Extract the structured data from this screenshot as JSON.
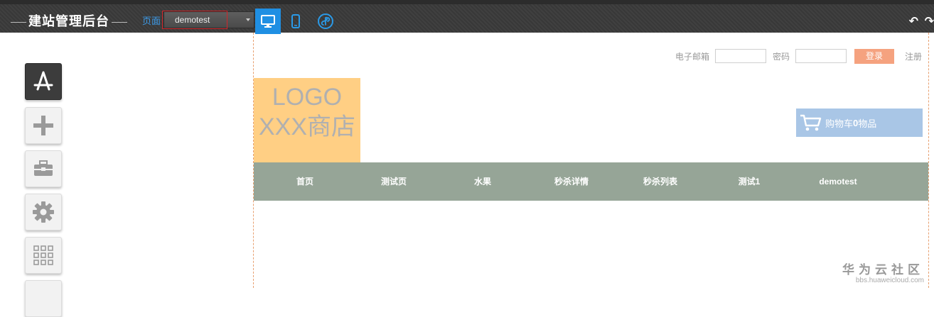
{
  "header": {
    "brand": "建站管理后台",
    "page_label": "页面",
    "page_select_value": "demotest",
    "devices": [
      "desktop-icon",
      "mobile-icon",
      "mini-program-icon"
    ],
    "undo_icon": "undo-icon",
    "redo_icon": "redo-icon",
    "accent_color": "#1f8fe3"
  },
  "tools": [
    "app-store-icon",
    "plus-icon",
    "toolbox-icon",
    "gear-icon",
    "grid-icon"
  ],
  "site": {
    "login": {
      "email_label": "电子邮箱",
      "password_label": "密码",
      "login_button": "登录",
      "register_link": "注册"
    },
    "logo_line1": "LOGO",
    "logo_line2": "XXX商店",
    "cart": {
      "prefix": "购物车",
      "count": "0",
      "suffix": "物品"
    },
    "nav": [
      "首页",
      "测试页",
      "水果",
      "秒杀详情",
      "秒杀列表",
      "测试1",
      "demotest"
    ]
  },
  "watermark": {
    "title": "华为云社区",
    "url": "bbs.huaweicloud.com"
  }
}
